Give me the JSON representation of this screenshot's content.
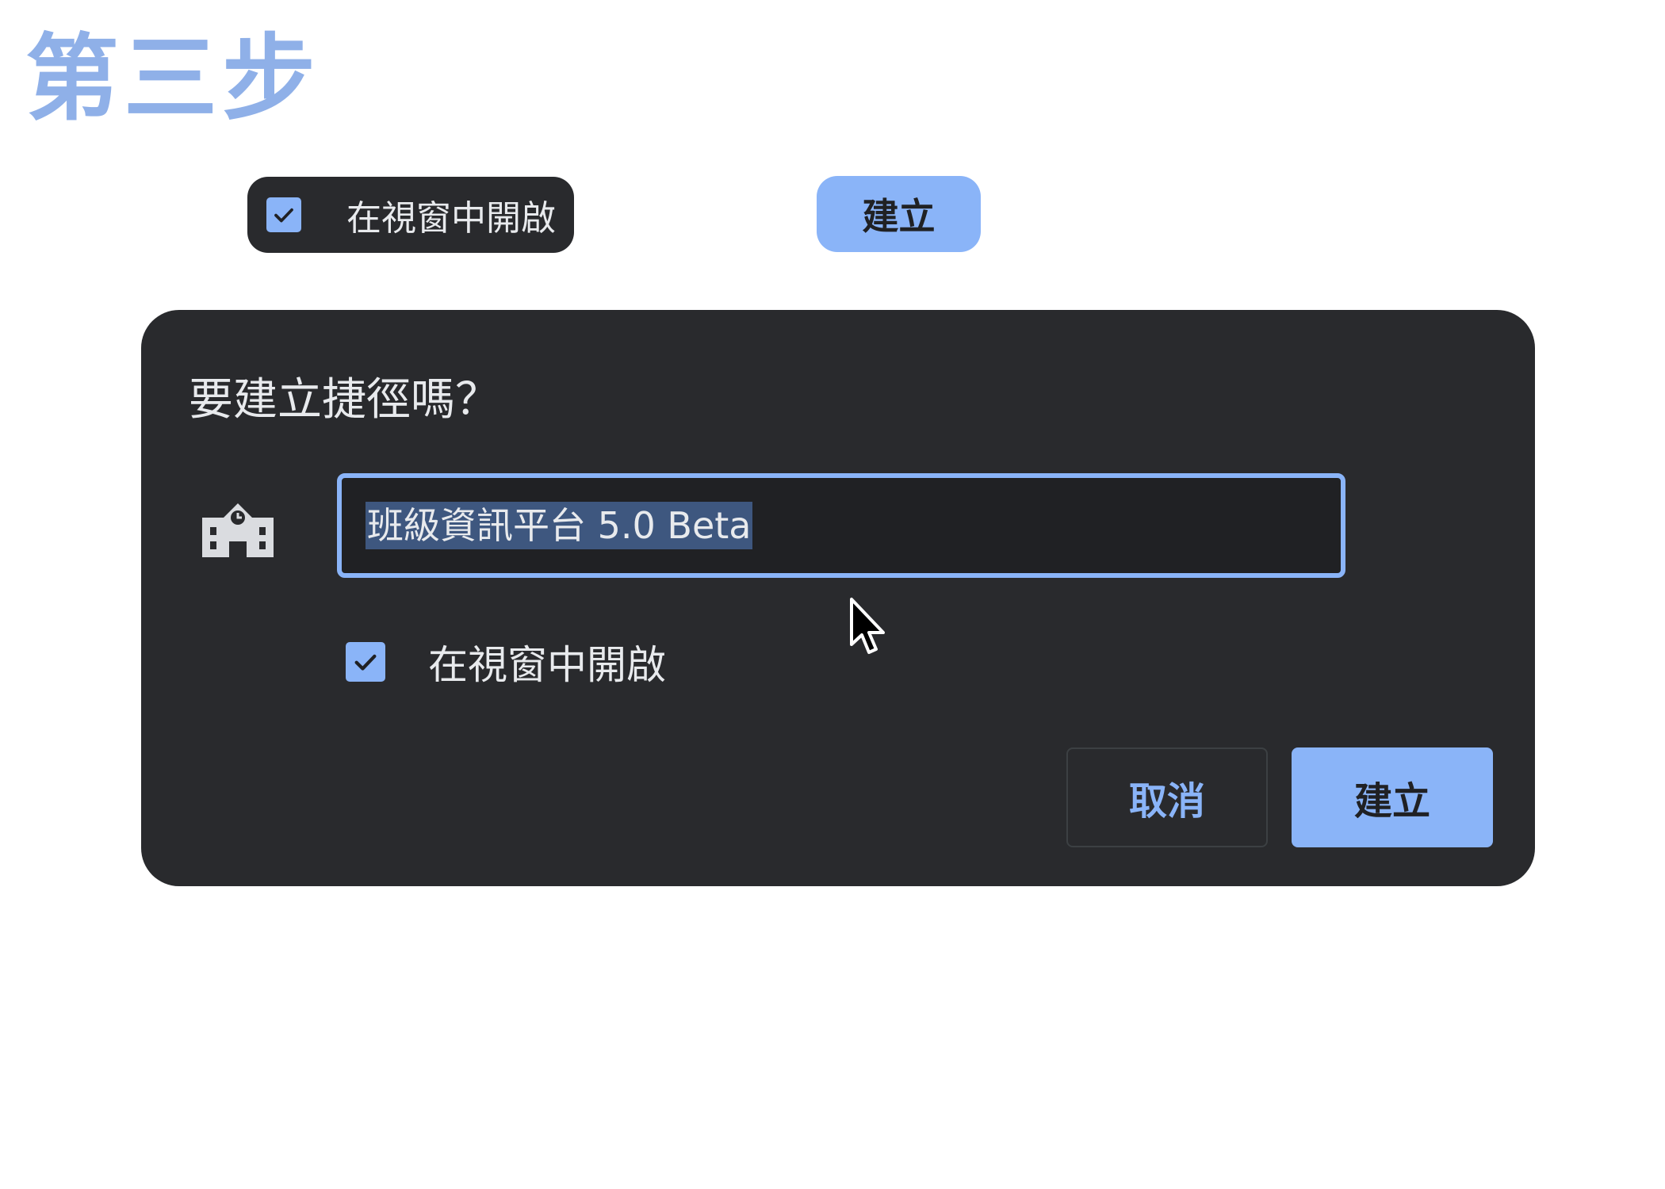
{
  "step_title": "第三步",
  "callouts": {
    "checkbox_label": "在視窗中開啟",
    "checkbox_checked": true,
    "create_label": "建立"
  },
  "dialog": {
    "title": "要建立捷徑嗎？",
    "app_icon": "school-icon",
    "name_input_value": "班級資訊平台 5.0 Beta",
    "name_input_selected": true,
    "open_in_window_label": "在視窗中開啟",
    "open_in_window_checked": true,
    "cancel_label": "取消",
    "create_label": "建立"
  },
  "colors": {
    "accent": "#8ab4f8",
    "dialog_bg": "#292a2d",
    "step_title": "#8fb0e8"
  }
}
